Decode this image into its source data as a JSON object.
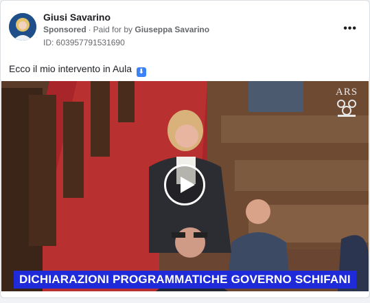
{
  "post": {
    "author_name": "Giusi Savarino",
    "sponsored_label": "Sponsored",
    "paid_for_label": "Paid for by",
    "payer_name": "Giuseppa Savarino",
    "ad_id": "ID: 603957791531690",
    "more_label": "•••",
    "caption": "Ecco il mio intervento in Aula",
    "caption_emoji": "⬇",
    "emoji_name": "down-arrow-emoji"
  },
  "video": {
    "channel_logo_text": "ARS",
    "lower_third": "DICHIARAZIONI PROGRAMMATICHE GOVERNO SCHIFANI",
    "lower_third_color": "#1f2bd8",
    "play_icon": "play-icon"
  },
  "colors": {
    "card_bg": "#ffffff",
    "page_bg": "#f0f2f5",
    "secondary_text": "#65676b"
  }
}
